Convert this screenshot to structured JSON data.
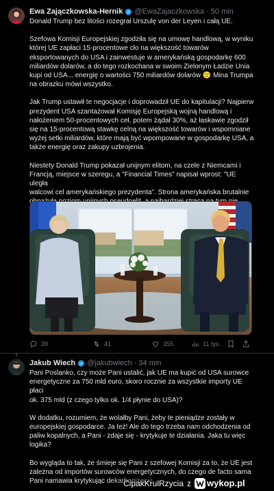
{
  "tweets": [
    {
      "author": {
        "name": "Ewa Zajączkowska-Hernik",
        "handle": "@EwaZajaczkowska",
        "verified": true
      },
      "separator": "·",
      "time": "50 min",
      "paragraphs": [
        "Donald Trump bez litości rozegrał Urszulę von der Leyen i całą UE.",
        "Szefowa Komisji Europejskiej zgodziła się na umowę handlową, w wyniku\nktórej UE zapłaci 15-procentowe cło na większość towarów\neksportowanych do USA i zainwestuje w amerykańską gospodarkę 600\nmiliardów dolarów, a do tego rozkochana w swoim Zielonym Ładzie Unia\nkupi od USA... energię o wartości 750 miliardów dolarów 🙁 Mina Trumpa\nna obrazku mówi wszystko.",
        "Jak Trump ustawił te negocjacje i doprowadził UE do kapitulacji? Najpierw\nprezydent USA szantażował Komisję Europejską wojną handlową i\nnałożeniem 50-procentowych ceł, potem żądał 30%, aż łaskawie zgodził\nsię na 15-procentową stawkę celną na większość towarów i wspomniane\nwyżej setki miliardów, które mają być wpompowane w gospodarkę USA, a\ntakże energię oraz zakupy uzbrojenia.",
        "Niestety Donald Trump pokazał unijnym elitom, na czele z Niemcami i\nFrancją, miejsce w szeregu, a \"Financial Times\" napisał wprost: \"UE uległa\nwalcowi cel amerykańskiego prezydenta\". Strona amerykańska brutalnie\nobnażyła poziom unijnych pseudoelit, a najbardziej stracą na tym nie\nbrukselscy możnowładcy, tylko my, zwykli konsumenci oraz producenci."
      ],
      "actions": {
        "replies": "39",
        "reposts": "41",
        "likes": "355",
        "views": "11 tys."
      }
    },
    {
      "author": {
        "name": "Jakub Wiech",
        "handle": "@jakubwiech",
        "verified": true
      },
      "separator": "·",
      "time": "34 min",
      "paragraphs": [
        "Pani Poslanko, czy może Pani ustalić, jak UE ma kupić od USA surowce\nenergetyczne za 750 mld euro, skoro rocznie za wszystkie importy UE płaci\nok. 375 mld (z czego tylko ok. 1/4 płynie do USA)?",
        "W dodatku, rozumiem, że wolałby Pani, żeby te pieniądze zostały w\neuropejskiej gospodarce. Ja też! Ale do tego trzeba nam odchodzenia od\npaliw kopalnych, a Pani - zdaje się - krytykuje te działania. Jaka tu więc\nlogika?",
        "Bo wygląda to tak, że śmieje się Pani z szefowej Komisji za to, że UE jest\nzależna od importów surowców energetycznych, do czego de facto sama\nPani namawia krytykując dekarbonizację."
      ]
    }
  ],
  "watermark": {
    "user": "CipakKrulRzycia",
    "word": "z",
    "site": "wykop.pl"
  },
  "colors": {
    "background": "#000000",
    "text": "#e7e9ea",
    "muted": "#71767b",
    "verified": "#1d9bf0",
    "separator": "#2f3336"
  }
}
